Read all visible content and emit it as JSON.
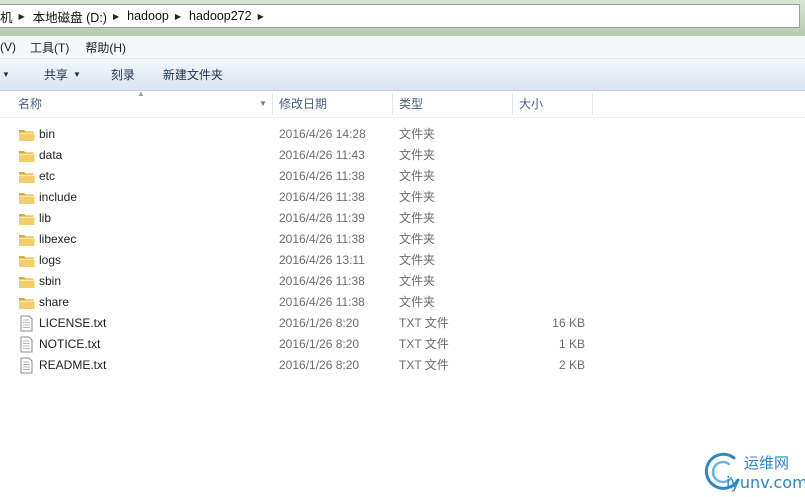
{
  "address_bar": {
    "crumbs": [
      {
        "label": "机"
      },
      {
        "label": "本地磁盘 (D:)"
      },
      {
        "label": "hadoop"
      },
      {
        "label": "hadoop272"
      }
    ]
  },
  "menu": {
    "items": [
      {
        "label": "(V)"
      },
      {
        "label": "工具(T)"
      },
      {
        "label": "帮助(H)"
      }
    ]
  },
  "toolbar": {
    "share_label": "共享",
    "burn_label": "刻录",
    "new_folder_label": "新建文件夹"
  },
  "columns": {
    "name": "名称",
    "modified": "修改日期",
    "type": "类型",
    "size": "大小"
  },
  "files": [
    {
      "name": "bin",
      "modified": "2016/4/26 14:28",
      "type": "文件夹",
      "size": "",
      "icon": "folder-icon"
    },
    {
      "name": "data",
      "modified": "2016/4/26 11:43",
      "type": "文件夹",
      "size": "",
      "icon": "folder-icon"
    },
    {
      "name": "etc",
      "modified": "2016/4/26 11:38",
      "type": "文件夹",
      "size": "",
      "icon": "folder-icon"
    },
    {
      "name": "include",
      "modified": "2016/4/26 11:38",
      "type": "文件夹",
      "size": "",
      "icon": "folder-icon"
    },
    {
      "name": "lib",
      "modified": "2016/4/26 11:39",
      "type": "文件夹",
      "size": "",
      "icon": "folder-icon"
    },
    {
      "name": "libexec",
      "modified": "2016/4/26 11:38",
      "type": "文件夹",
      "size": "",
      "icon": "folder-icon"
    },
    {
      "name": "logs",
      "modified": "2016/4/26 13:11",
      "type": "文件夹",
      "size": "",
      "icon": "folder-icon"
    },
    {
      "name": "sbin",
      "modified": "2016/4/26 11:38",
      "type": "文件夹",
      "size": "",
      "icon": "folder-icon"
    },
    {
      "name": "share",
      "modified": "2016/4/26 11:38",
      "type": "文件夹",
      "size": "",
      "icon": "folder-icon"
    },
    {
      "name": "LICENSE.txt",
      "modified": "2016/1/26 8:20",
      "type": "TXT 文件",
      "size": "16 KB",
      "icon": "text-file-icon"
    },
    {
      "name": "NOTICE.txt",
      "modified": "2016/1/26 8:20",
      "type": "TXT 文件",
      "size": "1 KB",
      "icon": "text-file-icon"
    },
    {
      "name": "README.txt",
      "modified": "2016/1/26 8:20",
      "type": "TXT 文件",
      "size": "2 KB",
      "icon": "text-file-icon"
    }
  ],
  "watermark": {
    "cn_text": "运维网",
    "site_text": "iyunv.com"
  },
  "colors": {
    "header_text": "#4c607a",
    "secondary_text": "#6d6d6d",
    "folder": "#e8c05a",
    "watermark": "#2c86c8"
  }
}
